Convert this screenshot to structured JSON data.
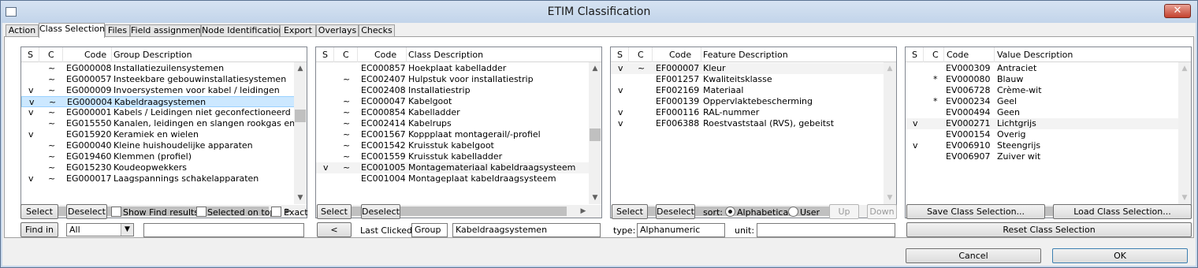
{
  "window": {
    "title": "ETIM Classification",
    "close_glyph": "✕"
  },
  "tabs": [
    "Action",
    "Class Selection",
    "Files",
    "Field assignment",
    "Node Identification",
    "Export",
    "Overlays",
    "Checks"
  ],
  "groups": {
    "headers": {
      "s": "S",
      "c": "C",
      "code": "Code",
      "desc": "Group Description"
    },
    "rows": [
      {
        "s": "",
        "c": "~",
        "code": "EG000008",
        "desc": "Installatiezuilensystemen"
      },
      {
        "s": "",
        "c": "~",
        "code": "EG000057",
        "desc": "Insteekbare gebouwinstallatiesystemen"
      },
      {
        "s": "v",
        "c": "~",
        "code": "EG000009",
        "desc": "Invoersystemen voor kabel / leidingen"
      },
      {
        "s": "v",
        "c": "~",
        "code": "EG000004",
        "desc": "Kabeldraagsystemen"
      },
      {
        "s": "v",
        "c": "~",
        "code": "EG000001",
        "desc": "Kabels / Leidingen niet geconfectioneerd"
      },
      {
        "s": "",
        "c": "~",
        "code": "EG015550",
        "desc": "Kanalen, leidingen en slangen rookgas en lucht"
      },
      {
        "s": "v",
        "c": "",
        "code": "EG015920",
        "desc": "Keramiek en wielen"
      },
      {
        "s": "",
        "c": "~",
        "code": "EG000040",
        "desc": "Kleine huishoudelijke apparaten"
      },
      {
        "s": "",
        "c": "~",
        "code": "EG019460",
        "desc": "Klemmen (profiel)"
      },
      {
        "s": "",
        "c": "~",
        "code": "EG015230",
        "desc": "Koudeopwekkers"
      },
      {
        "s": "v",
        "c": "~",
        "code": "EG000017",
        "desc": "Laagspannings schakelapparaten"
      }
    ]
  },
  "classes": {
    "headers": {
      "s": "S",
      "c": "C",
      "code": "Code",
      "desc": "Class Description"
    },
    "rows": [
      {
        "s": "",
        "c": "",
        "code": "EC000857",
        "desc": "Hoekplaat kabelladder"
      },
      {
        "s": "",
        "c": "~",
        "code": "EC002407",
        "desc": "Hulpstuk voor installatiestrip"
      },
      {
        "s": "",
        "c": "",
        "code": "EC002408",
        "desc": "Installatiestrip"
      },
      {
        "s": "",
        "c": "~",
        "code": "EC000047",
        "desc": "Kabelgoot"
      },
      {
        "s": "",
        "c": "~",
        "code": "EC000854",
        "desc": "Kabelladder"
      },
      {
        "s": "",
        "c": "~",
        "code": "EC002414",
        "desc": "Kabelrups"
      },
      {
        "s": "",
        "c": "~",
        "code": "EC001567",
        "desc": "Koppplaat montagerail/-profiel"
      },
      {
        "s": "",
        "c": "~",
        "code": "EC001542",
        "desc": "Kruisstuk kabelgoot"
      },
      {
        "s": "",
        "c": "~",
        "code": "EC001559",
        "desc": "Kruisstuk kabelladder"
      },
      {
        "s": "v",
        "c": "~",
        "code": "EC001005",
        "desc": "Montagemateriaal kabeldraagsysteem"
      },
      {
        "s": "",
        "c": "",
        "code": "EC001004",
        "desc": "Montageplaat kabeldraagsysteem"
      }
    ]
  },
  "features": {
    "headers": {
      "s": "S",
      "c": "C",
      "code": "Code",
      "desc": "Feature Description"
    },
    "rows": [
      {
        "s": "v",
        "c": "~",
        "code": "EF000007",
        "desc": "Kleur"
      },
      {
        "s": "",
        "c": "",
        "code": "EF001257",
        "desc": "Kwaliteitsklasse"
      },
      {
        "s": "v",
        "c": "",
        "code": "EF002169",
        "desc": "Materiaal"
      },
      {
        "s": "",
        "c": "",
        "code": "EF000139",
        "desc": "Oppervlaktebescherming"
      },
      {
        "s": "v",
        "c": "",
        "code": "EF000116",
        "desc": "RAL-nummer"
      },
      {
        "s": "v",
        "c": "",
        "code": "EF006388",
        "desc": "Roestvaststaal (RVS), gebeitst"
      }
    ]
  },
  "values": {
    "headers": {
      "s": "S",
      "c": "C",
      "code": "Code",
      "desc": "Value Description"
    },
    "rows": [
      {
        "s": "",
        "c": "",
        "code": "EV000309",
        "desc": "Antraciet"
      },
      {
        "s": "",
        "c": "*",
        "code": "EV000080",
        "desc": "Blauw"
      },
      {
        "s": "",
        "c": "",
        "code": "EV006728",
        "desc": "Crème-wit"
      },
      {
        "s": "",
        "c": "*",
        "code": "EV000234",
        "desc": "Geel"
      },
      {
        "s": "",
        "c": "",
        "code": "EV000494",
        "desc": "Geen"
      },
      {
        "s": "v",
        "c": "",
        "code": "EV000271",
        "desc": "Lichtgrijs"
      },
      {
        "s": "",
        "c": "",
        "code": "EV000154",
        "desc": "Overig"
      },
      {
        "s": "v",
        "c": "",
        "code": "EV006910",
        "desc": "Steengrijs"
      },
      {
        "s": "",
        "c": "",
        "code": "EV006907",
        "desc": "Zuiver wit"
      }
    ]
  },
  "controls": {
    "select": "Select",
    "deselect": "Deselect",
    "show_find_results": "Show Find results",
    "selected_on_top": "Selected on top",
    "exact": "Exact",
    "find_in": "Find in",
    "find_in_value": "All",
    "find_text": "",
    "back": "<",
    "last_clicked_label": "Last Clicked:",
    "last_clicked_type": "Group",
    "last_clicked_value": "Kabeldraagsystemen",
    "sort_label": "sort:",
    "sort_alpha": "Alphabetical",
    "sort_user": "User",
    "up": "Up",
    "down": "Down",
    "type_label": "type:",
    "type_value": "Alphanumeric",
    "unit_label": "unit:",
    "unit_value": "",
    "save_class": "Save Class Selection...",
    "load_class": "Load Class Selection...",
    "reset_class": "Reset Class Selection",
    "cancel": "Cancel",
    "ok": "OK"
  }
}
